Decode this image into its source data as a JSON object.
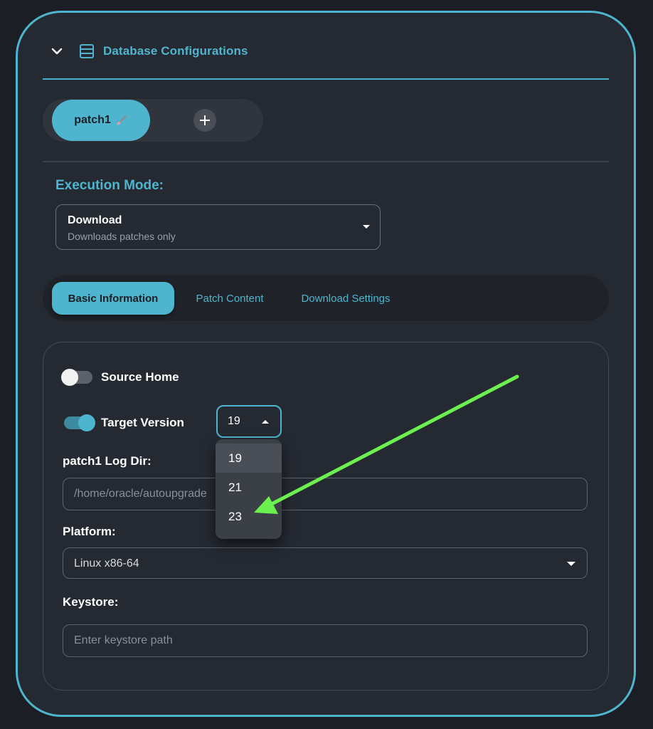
{
  "header": {
    "title": "Database Configurations",
    "collapse_icon": "chevron-down-icon",
    "section_icon": "database-icon"
  },
  "patch_tabs": {
    "active_label": "patch1",
    "edit_icon": "pencil-icon",
    "add_icon": "plus-icon"
  },
  "execution_mode": {
    "label": "Execution Mode:",
    "value": "Download",
    "description": "Downloads patches only"
  },
  "info_tabs": [
    "Basic Information",
    "Patch Content",
    "Download Settings"
  ],
  "form": {
    "source_home": {
      "label": "Source Home",
      "enabled": false
    },
    "target_version": {
      "label": "Target Version",
      "enabled": true,
      "value": "19",
      "options": [
        "19",
        "21",
        "23"
      ]
    },
    "log_dir": {
      "label": "patch1 Log Dir:",
      "value": "/home/oracle/autoupgrade"
    },
    "platform": {
      "label": "Platform:",
      "value": "Linux x86-64"
    },
    "keystore": {
      "label": "Keystore:",
      "placeholder": "Enter keystore path"
    }
  },
  "colors": {
    "accent": "#4fb5cf",
    "annotation_arrow": "#6cf04f",
    "background": "#252931"
  }
}
